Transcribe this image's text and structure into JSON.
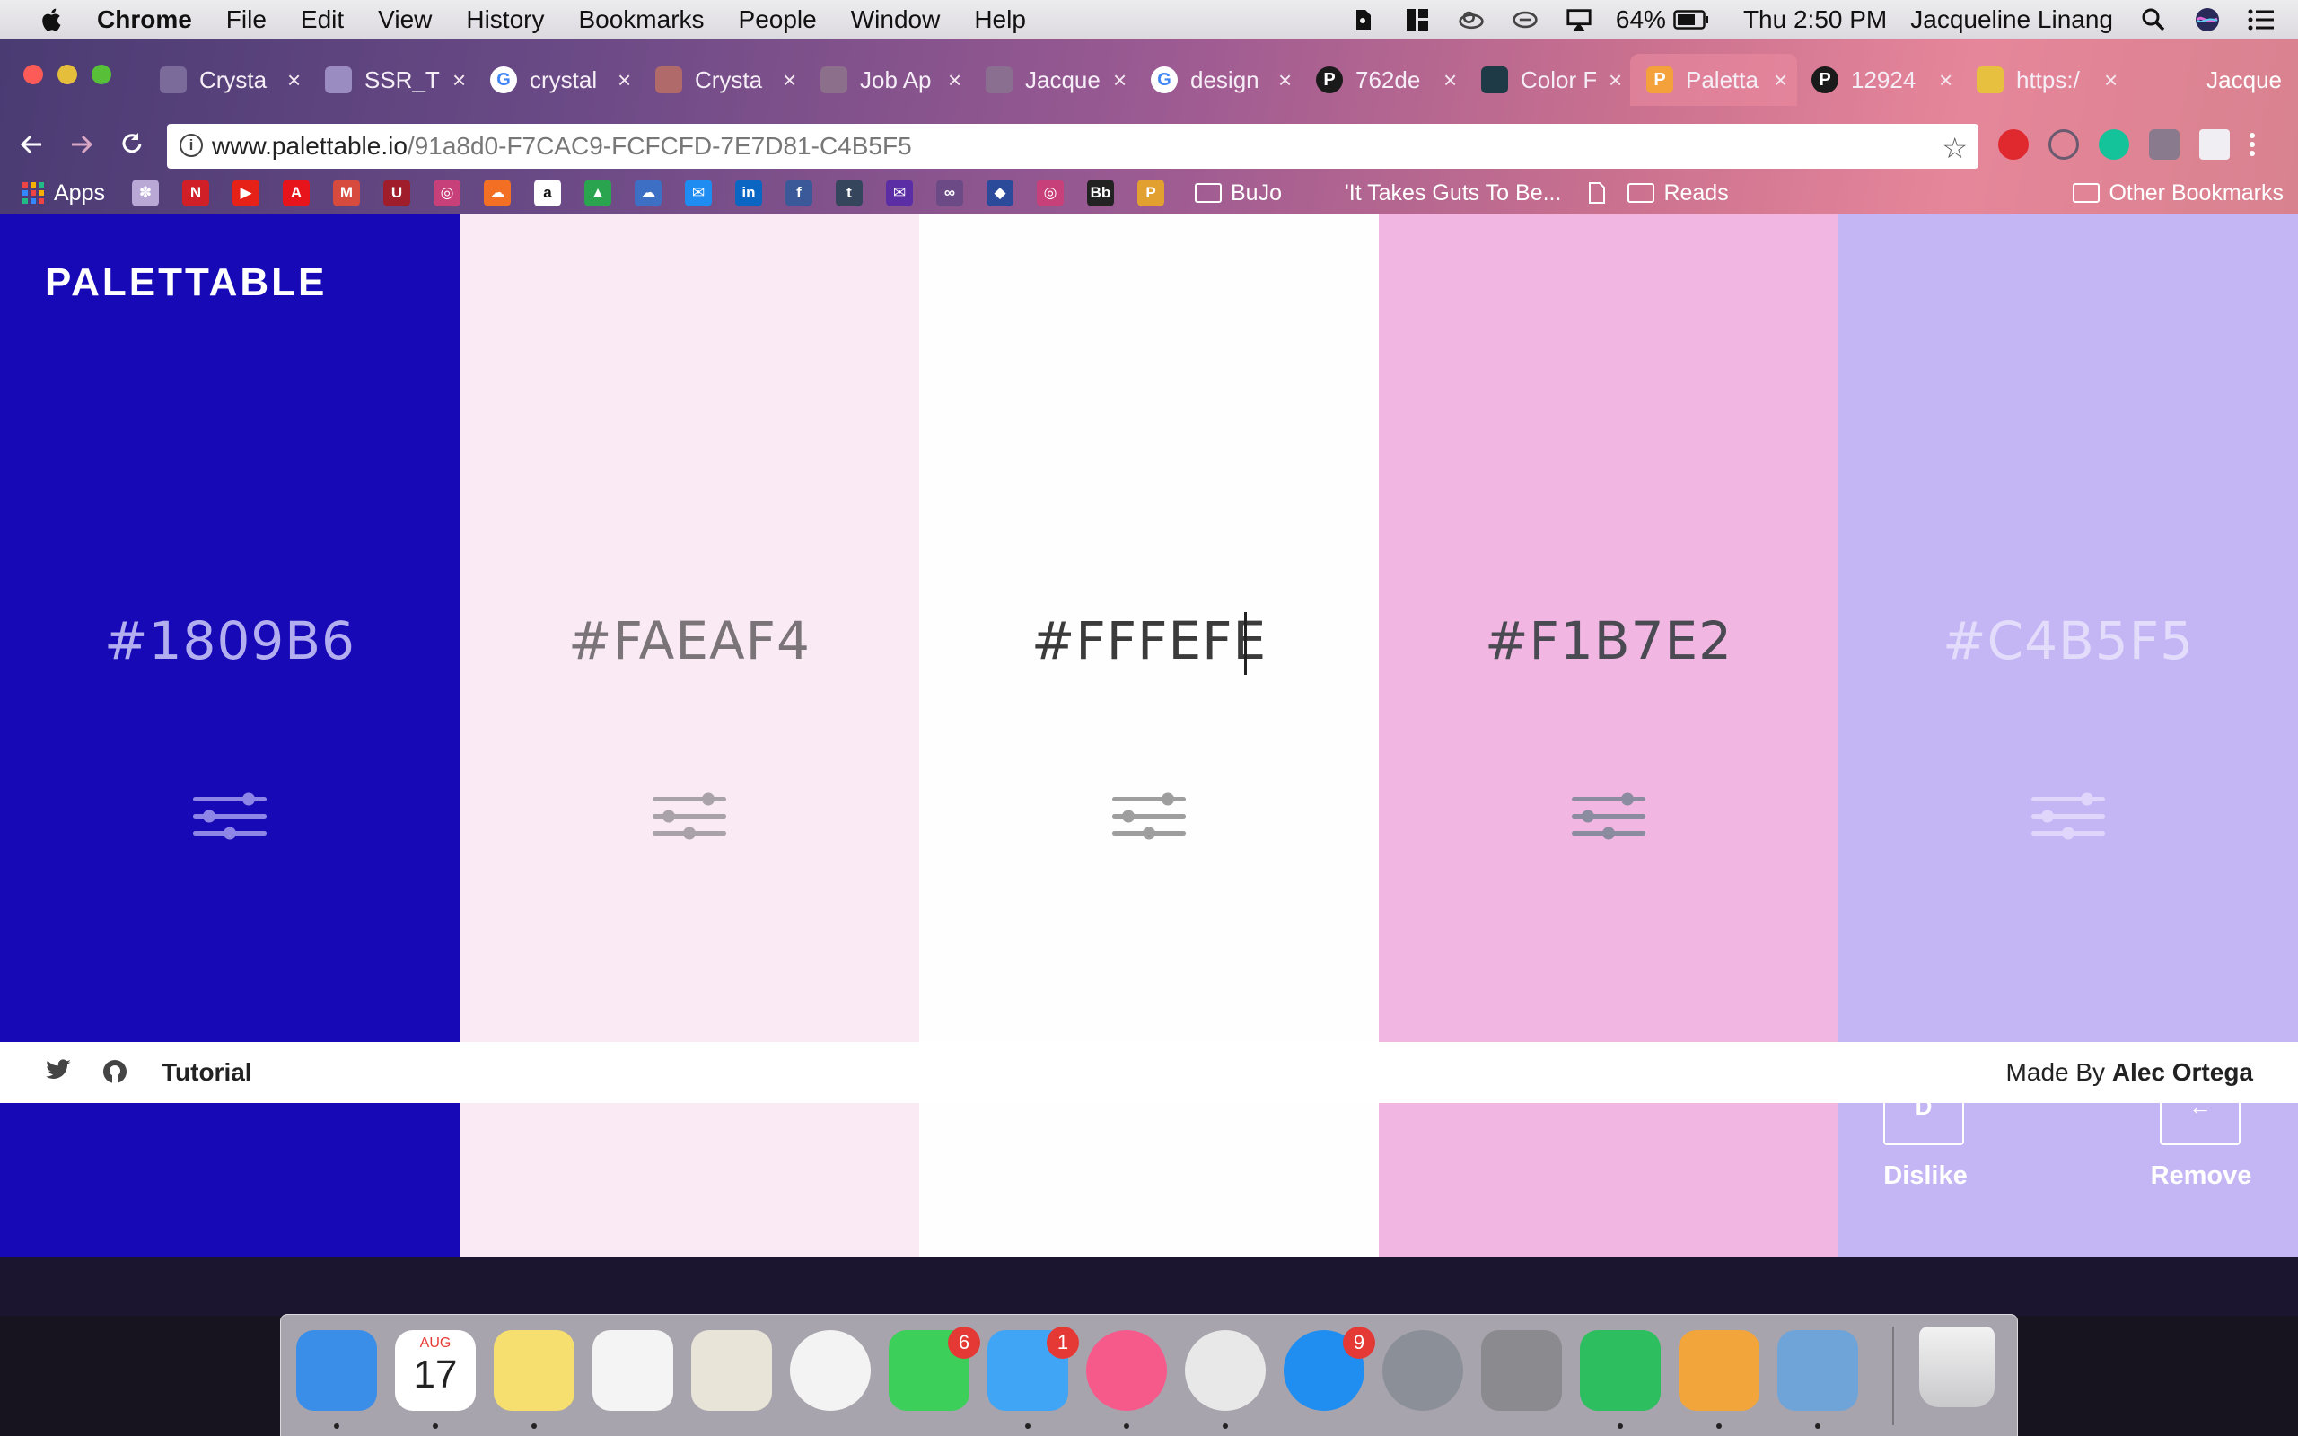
{
  "menubar": {
    "app_name": "Chrome",
    "menus": [
      "File",
      "Edit",
      "View",
      "History",
      "Bookmarks",
      "People",
      "Window",
      "Help"
    ],
    "battery": "64%",
    "clock": "Thu 2:50 PM",
    "user": "Jacqueline Linang",
    "status_icons": [
      "evernote-icon",
      "grid-icon",
      "cloud-icon",
      "sync-icon",
      "airplay-icon",
      "battery-icon",
      "search-icon",
      "siri-icon",
      "list-icon"
    ]
  },
  "tabs": [
    {
      "label": "Crysta",
      "icon": "image-favicon",
      "color": "#7a6b9a"
    },
    {
      "label": "SSR_T",
      "icon": "doc-favicon",
      "color": "#9a8cc0"
    },
    {
      "label": "crystal",
      "icon": "google-favicon",
      "color": "#ffffff"
    },
    {
      "label": "Crysta",
      "icon": "image-favicon",
      "color": "#b06a6a"
    },
    {
      "label": "Job Ap",
      "icon": "job-favicon",
      "color": "#8c6f8a"
    },
    {
      "label": "Jacque",
      "icon": "page-favicon",
      "color": "#8b6f90"
    },
    {
      "label": "design",
      "icon": "google-favicon",
      "color": "#ffffff"
    },
    {
      "label": "762de",
      "icon": "pinterest-favicon",
      "color": "#1a1a1a"
    },
    {
      "label": "Color F",
      "icon": "color-favicon",
      "color": "#1e3a46"
    },
    {
      "label": "Paletta",
      "icon": "palettable-favicon",
      "color": "#f4a03b"
    },
    {
      "label": "12924",
      "icon": "pinterest-favicon",
      "color": "#1a1a1a"
    },
    {
      "label": "https:/",
      "icon": "page-favicon",
      "color": "#e8c040"
    }
  ],
  "profile_name": "Jacque",
  "address": {
    "host": "www.palettable.io",
    "path": "/91a8d0-F7CAC9-FCFCFD-7E7D81-C4B5F5"
  },
  "bookmarks": {
    "apps_label": "Apps",
    "icons": [
      {
        "name": "bookmark-icon-1",
        "color": "#b9a7d6",
        "glyph": "✽"
      },
      {
        "name": "netflix-icon",
        "color": "#d01f26",
        "glyph": "N"
      },
      {
        "name": "youtube-icon",
        "color": "#e62117",
        "glyph": "▶"
      },
      {
        "name": "adobe-icon",
        "color": "#e8141b",
        "glyph": "A"
      },
      {
        "name": "gmail-icon",
        "color": "#d64b3d",
        "glyph": "M"
      },
      {
        "name": "school-icon",
        "color": "#a01e2c",
        "glyph": "U"
      },
      {
        "name": "instagram-icon",
        "color": "#c8407a",
        "glyph": "◎"
      },
      {
        "name": "soundcloud-icon",
        "color": "#f26f23",
        "glyph": "☁"
      },
      {
        "name": "amazon-icon",
        "color": "#ffffff",
        "glyph": "a"
      },
      {
        "name": "drive-icon",
        "color": "#2aa44f",
        "glyph": "▲"
      },
      {
        "name": "cloud-icon",
        "color": "#3d6fc4",
        "glyph": "☁"
      },
      {
        "name": "messenger-icon",
        "color": "#1f8cf2",
        "glyph": "✉"
      },
      {
        "name": "linkedin-icon",
        "color": "#0a66c2",
        "glyph": "in"
      },
      {
        "name": "facebook-icon",
        "color": "#3b5998",
        "glyph": "f"
      },
      {
        "name": "tumblr-icon",
        "color": "#35465c",
        "glyph": "t"
      },
      {
        "name": "mail-icon",
        "color": "#5b2ea6",
        "glyph": "✉"
      },
      {
        "name": "link-icon",
        "color": "#6b4a86",
        "glyph": "∞"
      },
      {
        "name": "app-icon",
        "color": "#2c4a9a",
        "glyph": "◆"
      },
      {
        "name": "instagram-icon-2",
        "color": "#c8407a",
        "glyph": "◎"
      },
      {
        "name": "blackboard-icon",
        "color": "#222222",
        "glyph": "Bb"
      },
      {
        "name": "google-photos-icon",
        "color": "#e2a030",
        "glyph": "P"
      }
    ],
    "folder_bujo": "BuJo",
    "item_guts": "'It Takes Guts To Be...",
    "folder_reads": "Reads",
    "other": "Other Bookmarks"
  },
  "palette": {
    "logo": "PALETTABLE",
    "swatches": [
      {
        "hex": "#1809B6",
        "text_color": "#b3aef0",
        "icon_color": "#8d86e6"
      },
      {
        "hex": "#FAEAF4",
        "text_color": "#7a7478",
        "icon_color": "#a9a2a8"
      },
      {
        "hex": "#FFFEFE",
        "text_color": "#3b3b3b",
        "icon_color": "#9e9e9e"
      },
      {
        "hex": "#F1B7E2",
        "text_color": "#4a4a52",
        "icon_color": "#8c8ca0"
      },
      {
        "hex": "#C4B5F5",
        "text_color": "#e4dcfb",
        "icon_color": "#e0d6fb"
      }
    ],
    "dislike_key": "D",
    "dislike_label": "Dislike",
    "remove_key": "←",
    "remove_label": "Remove"
  },
  "footer": {
    "tutorial": "Tutorial",
    "made_by": "Made By",
    "author": "Alec Ortega"
  },
  "dock": {
    "apps": [
      {
        "name": "finder-app",
        "color": "#3a8ee8",
        "running": true,
        "badge": ""
      },
      {
        "name": "calendar-app",
        "color": "#ffffff",
        "running": true,
        "badge": ""
      },
      {
        "name": "notes-app",
        "color": "#f7df6f",
        "running": true,
        "badge": ""
      },
      {
        "name": "reminders-app",
        "color": "#f4f4f4",
        "running": false,
        "badge": ""
      },
      {
        "name": "maps-app",
        "color": "#e9e4d8",
        "running": false,
        "badge": ""
      },
      {
        "name": "photos-app",
        "color": "#f3f3f3",
        "running": false,
        "badge": ""
      },
      {
        "name": "facetime-app",
        "color": "#3ccf5a",
        "running": false,
        "badge": "6"
      },
      {
        "name": "messages-app",
        "color": "#41a5f5",
        "running": true,
        "badge": "1"
      },
      {
        "name": "itunes-app",
        "color": "#f55a8b",
        "running": true,
        "badge": ""
      },
      {
        "name": "chrome-app",
        "color": "#e8e8e8",
        "running": true,
        "badge": ""
      },
      {
        "name": "app-store-app",
        "color": "#1f8ef0",
        "running": false,
        "badge": "9"
      },
      {
        "name": "launchpad-app",
        "color": "#8b8f98",
        "running": false,
        "badge": ""
      },
      {
        "name": "system-preferences-app",
        "color": "#8a8a8f",
        "running": false,
        "badge": ""
      },
      {
        "name": "evernote-app",
        "color": "#2dbe60",
        "running": true,
        "badge": ""
      },
      {
        "name": "pages-app",
        "color": "#f2a53a",
        "running": true,
        "badge": ""
      },
      {
        "name": "preview-app",
        "color": "#6fa4d8",
        "running": true,
        "badge": ""
      }
    ],
    "calendar_month": "AUG",
    "calendar_day": "17"
  }
}
